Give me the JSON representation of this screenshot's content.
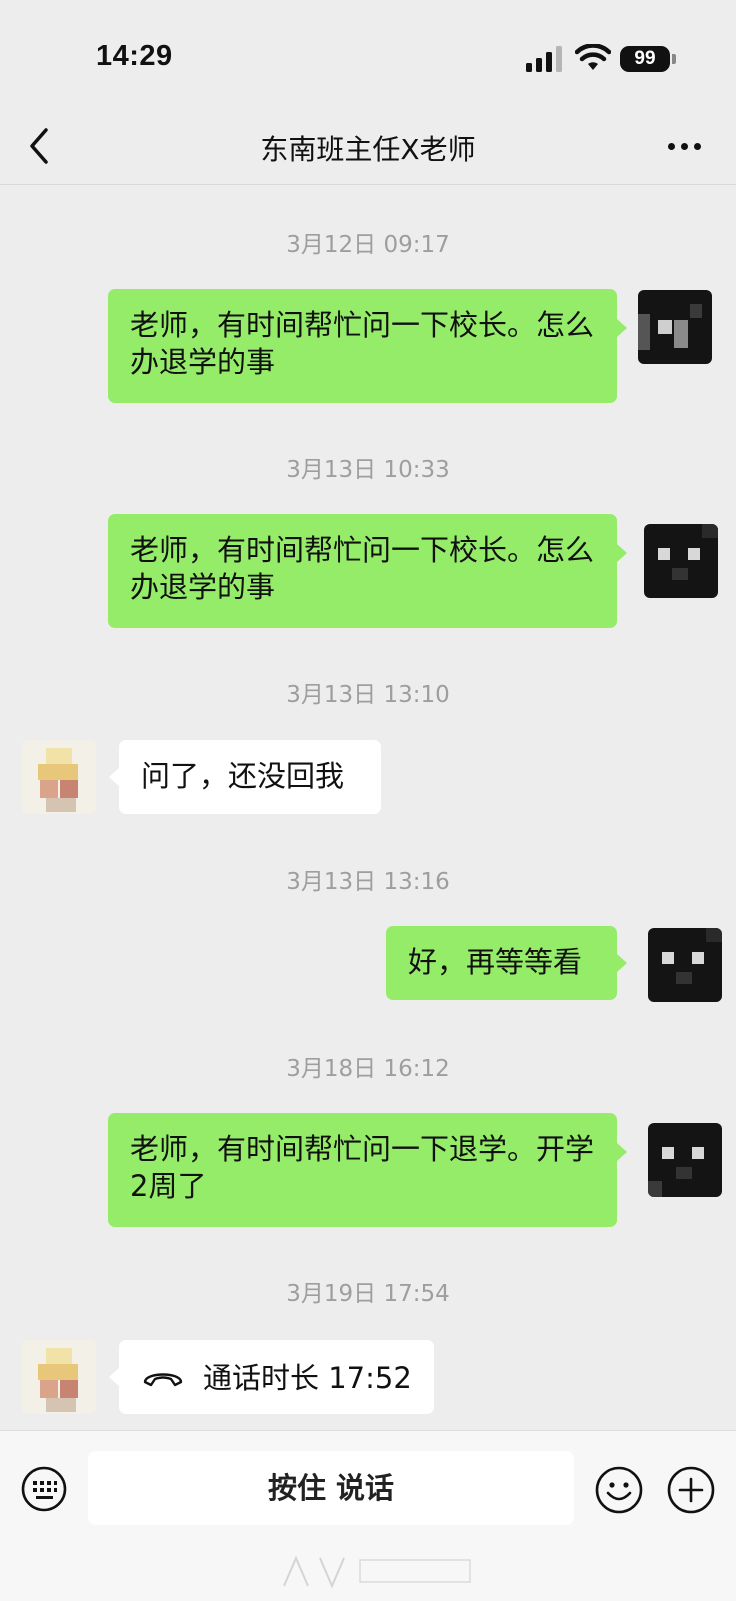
{
  "status_bar": {
    "time": "14:29",
    "battery_level": "99",
    "icons": [
      "signal-icon",
      "wifi-icon",
      "battery-icon"
    ]
  },
  "nav": {
    "title": "东南班主任X老师",
    "icons": [
      "back-chevron-icon",
      "more-icon"
    ]
  },
  "messages": [
    {
      "type": "timestamp",
      "text": "3月12日 09:17"
    },
    {
      "type": "outgoing",
      "text": "老师，有时间帮忙问一下校长。怎么办退学的事"
    },
    {
      "type": "timestamp",
      "text": "3月13日 10:33"
    },
    {
      "type": "outgoing",
      "text": "老师，有时间帮忙问一下校长。怎么办退学的事"
    },
    {
      "type": "timestamp",
      "text": "3月13日 13:10"
    },
    {
      "type": "incoming",
      "text": "问了，还没回我"
    },
    {
      "type": "timestamp",
      "text": "3月13日 13:16"
    },
    {
      "type": "outgoing",
      "text": "好，再等等看"
    },
    {
      "type": "timestamp",
      "text": "3月18日 16:12"
    },
    {
      "type": "outgoing",
      "text": "老师，有时间帮忙问一下退学。开学2周了"
    },
    {
      "type": "timestamp",
      "text": "3月19日 17:54"
    },
    {
      "type": "incoming_call",
      "text": "通话时长 17:52"
    }
  ],
  "input_bar": {
    "hold_to_talk_label": "按住 说话",
    "icons": [
      "keyboard-icon",
      "emoji-icon",
      "plus-icon"
    ]
  },
  "colors": {
    "background": "#ededed",
    "outgoing_bubble": "#95ec69",
    "incoming_bubble": "#ffffff",
    "timestamp_text": "#9e9e9e"
  }
}
